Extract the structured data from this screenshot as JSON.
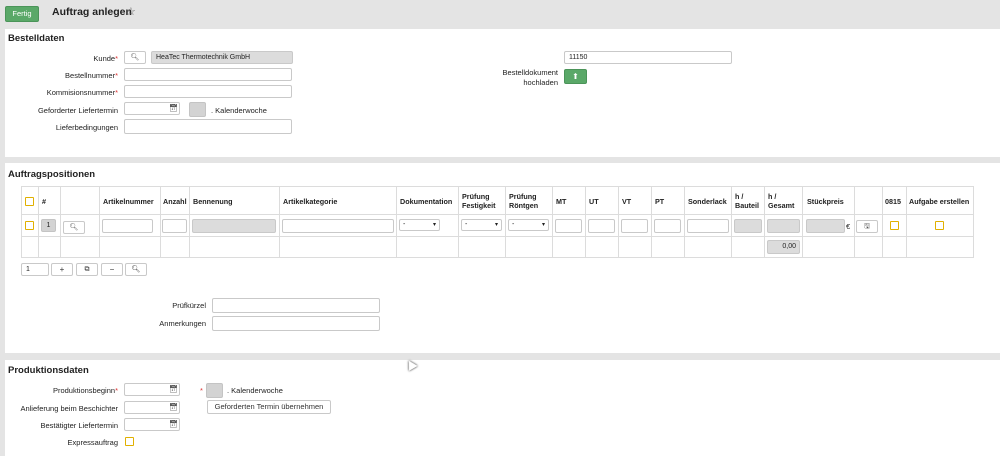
{
  "topbar": {
    "done_label": "Fertig",
    "title": "Auftrag anlegen",
    "star_icon": "star-outline-icon"
  },
  "bestelldaten": {
    "title": "Bestelldaten",
    "kunde_label": "Kunde",
    "kunde_value": "HeaTec Thermotechnik GmbH",
    "bestellnummer_label": "Bestellnummer",
    "bestellnummer_value": "",
    "kommission_label": "Kommisionsnummer",
    "kommission_value": "",
    "liefertermin_label": "Geforderter Liefertermin",
    "liefertermin_value": "",
    "kw_label": ". Kalenderwoche",
    "lieferbedingungen_label": "Lieferbedingungen",
    "lieferbedingungen_value": "",
    "right_value": "11150",
    "dokument_label_1": "Bestelldokument",
    "dokument_label_2": "hochladen"
  },
  "auftragspositionen": {
    "title": "Auftragspositionen",
    "columns": [
      "#",
      "Artikelnummer",
      "Anzahl",
      "Bennenung",
      "Artikelkategorie",
      "Dokumentation",
      "Prüfung",
      "Festigkeit",
      "Prüfung",
      "Röntgen",
      "MT",
      "UT",
      "VT",
      "PT",
      "Sonderlack",
      "h /",
      "Bauteil",
      "h /",
      "Gesamt",
      "Stückpreis",
      "0815",
      "Aufgabe erstellen"
    ],
    "row": {
      "index": "1",
      "dokumentation": "-",
      "festigkeit": "-",
      "roentgen": "-",
      "currency": "€"
    },
    "total": "0,00",
    "page": "1",
    "pruefkuerzel_label": "Prüfkürzel",
    "anmerkungen_label": "Anmerkungen"
  },
  "produktionsdaten": {
    "title": "Produktionsdaten",
    "beginn_label": "Produktionsbeginn",
    "kw_label": ". Kalenderwoche",
    "anlieferung_label": "Anlieferung beim Beschichter",
    "bestaetigt_label": "Bestätigter Liefertermin",
    "express_label": "Expressauftrag",
    "uebernehmen_label": "Geforderten Termin übernehmen"
  }
}
